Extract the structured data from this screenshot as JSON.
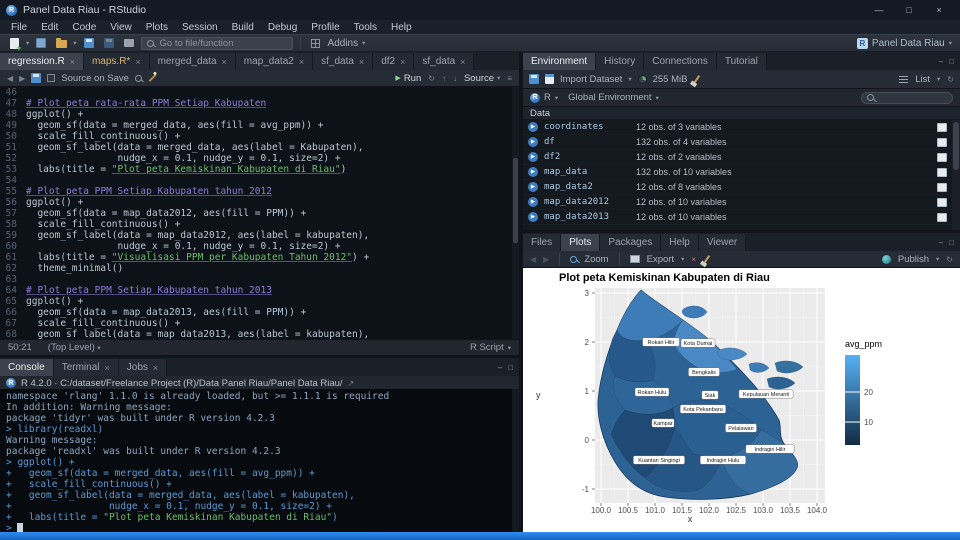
{
  "window": {
    "title": "Panel Data Riau - RStudio",
    "menus": [
      "File",
      "Edit",
      "Code",
      "View",
      "Plots",
      "Session",
      "Build",
      "Debug",
      "Profile",
      "Tools",
      "Help"
    ],
    "controls": {
      "minimize": "—",
      "maximize": "□",
      "close": "×"
    }
  },
  "main_toolbar": {
    "goto_placeholder": "Go to file/function",
    "addins_label": "Addins",
    "project_label": "Panel Data Riau"
  },
  "source_pane": {
    "tabs": [
      {
        "label": "regression.R",
        "active": true,
        "close": true
      },
      {
        "label": "maps.R*",
        "modified": true,
        "close": true
      },
      {
        "label": "merged_data",
        "close": true
      },
      {
        "label": "map_data2",
        "close": true
      },
      {
        "label": "sf_data",
        "close": true
      },
      {
        "label": "df2",
        "close": true
      },
      {
        "label": "sf_data",
        "close": true
      }
    ],
    "toolbar": {
      "source_on_save": "Source on Save",
      "run_label": "Run",
      "source_label": "Source"
    },
    "start_line": 46,
    "code_lines": [
      "",
      "# Plot peta rata-rata PPM Setiap Kabupaten",
      "ggplot() +",
      "  geom_sf(data = merged_data, aes(fill = avg_ppm)) +",
      "  scale_fill_continuous() +",
      "  geom_sf_label(data = merged_data, aes(label = Kabupaten),",
      "                nudge_x = 0.1, nudge_y = 0.1, size=2) +",
      "  labs(title = \"Plot peta Kemiskinan Kabupaten di Riau\")",
      "",
      "# Plot peta PPM Setiap Kabupaten tahun 2012",
      "ggplot() +",
      "  geom_sf(data = map_data2012, aes(fill = PPM)) +",
      "  scale_fill_continuous() +",
      "  geom_sf_label(data = map_data2012, aes(label = kabupaten),",
      "                nudge_x = 0.1, nudge_y = 0.1, size=2) +",
      "  labs(title = \"Visualisasi PPM per Kabupaten Tahun 2012\") +",
      "  theme_minimal()",
      "",
      "# Plot peta PPM Setiap Kabupaten tahun 2013",
      "ggplot() +",
      "  geom_sf(data = map_data2013, aes(fill = PPM)) +",
      "  scale_fill_continuous() +",
      "  geom_sf_label(data = map_data2013, aes(label = kabupaten),"
    ],
    "status": {
      "cursor": "50:21",
      "scope": "(Top Level)",
      "file_type": "R Script"
    }
  },
  "console_pane": {
    "tabs": [
      {
        "label": "Console",
        "active": true
      },
      {
        "label": "Terminal",
        "close": true
      },
      {
        "label": "Jobs",
        "close": true
      }
    ],
    "header": "R 4.2.0 · C:/dataset/Freelance Project (R)/Data Panel Riau/Panel Data Riau/",
    "lines": [
      {
        "type": "info",
        "text": "namespace 'rlang' 1.1.0 is already loaded, but >= 1.1.1 is required"
      },
      {
        "type": "info",
        "text": "In addition: Warning message:"
      },
      {
        "type": "info",
        "text": "package 'tidyr' was built under R version 4.2.3"
      },
      {
        "type": "cmd",
        "text": "> library(readxl)"
      },
      {
        "type": "info",
        "text": "Warning message:"
      },
      {
        "type": "info",
        "text": "package 'readxl' was built under R version 4.2.3"
      },
      {
        "type": "cmd",
        "text": "> ggplot() +"
      },
      {
        "type": "cmd",
        "text": "+   geom_sf(data = merged_data, aes(fill = avg_ppm)) +"
      },
      {
        "type": "cmd",
        "text": "+   scale_fill_continuous() +"
      },
      {
        "type": "cmd",
        "text": "+   geom_sf_label(data = merged_data, aes(label = kabupaten),"
      },
      {
        "type": "cmd",
        "text": "+                 nudge_x = 0.1, nudge_y = 0.1, size=2) +"
      },
      {
        "type": "cmd",
        "text": "+   labs(title = \"Plot peta Kemiskinan Kabupaten di Riau\")"
      },
      {
        "type": "prompt",
        "text": "> "
      }
    ]
  },
  "environment_pane": {
    "tabs": [
      {
        "label": "Environment",
        "active": true
      },
      {
        "label": "History"
      },
      {
        "label": "Connections"
      },
      {
        "label": "Tutorial"
      }
    ],
    "toolbar": {
      "import_label": "Import Dataset",
      "memory_label": "255 MiB",
      "list_label": "List"
    },
    "selectors": {
      "language": "R",
      "scope": "Global Environment"
    },
    "section_label": "Data",
    "objects": [
      {
        "name": "coordinates",
        "desc": "12 obs. of 3 variables"
      },
      {
        "name": "df",
        "desc": "132 obs. of 4 variables"
      },
      {
        "name": "df2",
        "desc": "12 obs. of 2 variables"
      },
      {
        "name": "map_data",
        "desc": "132 obs. of 10 variables"
      },
      {
        "name": "map_data2",
        "desc": "12 obs. of 8 variables"
      },
      {
        "name": "map_data2012",
        "desc": "12 obs. of 10 variables"
      },
      {
        "name": "map_data2013",
        "desc": "12 obs. of 10 variables"
      }
    ]
  },
  "plots_pane": {
    "tabs": [
      {
        "label": "Files"
      },
      {
        "label": "Plots",
        "active": true
      },
      {
        "label": "Packages"
      },
      {
        "label": "Help"
      },
      {
        "label": "Viewer"
      }
    ],
    "toolbar": {
      "zoom_label": "Zoom",
      "export_label": "Export",
      "publish_label": "Publish"
    },
    "chart_data": {
      "type": "choropleth-map",
      "title": "Plot peta Kemiskinan Kabupaten di Riau",
      "xlabel": "x",
      "ylabel": "y",
      "x_ticks": [
        "100.0",
        "100.5",
        "101.0",
        "101.5",
        "102.0",
        "102.5",
        "103.0",
        "103.5",
        "104.0"
      ],
      "y_ticks": [
        "3",
        "2",
        "1",
        "0",
        "-1"
      ],
      "legend": {
        "title": "avg_ppm",
        "ticks": [
          "20",
          "10"
        ],
        "high_color": "#56B1F7",
        "low_color": "#132B43"
      },
      "regions": [
        {
          "label": "Rokan Hilir",
          "x": 138,
          "y": 74
        },
        {
          "label": "Kota Dumai",
          "x": 175,
          "y": 75
        },
        {
          "label": "Bengkalis",
          "x": 181,
          "y": 104
        },
        {
          "label": "Rokan Hulu",
          "x": 129,
          "y": 124
        },
        {
          "label": "Siak",
          "x": 187,
          "y": 127
        },
        {
          "label": "Kepulauan Meranti",
          "x": 243,
          "y": 126
        },
        {
          "label": "Kota Pekanbaru",
          "x": 180,
          "y": 141
        },
        {
          "label": "Kampar",
          "x": 140,
          "y": 155
        },
        {
          "label": "Pelalawan",
          "x": 218,
          "y": 160
        },
        {
          "label": "Kuantan Singingi",
          "x": 136,
          "y": 192
        },
        {
          "label": "Indragiri Hulu",
          "x": 200,
          "y": 192
        },
        {
          "label": "Indragiri Hilir",
          "x": 247,
          "y": 181
        }
      ]
    }
  }
}
